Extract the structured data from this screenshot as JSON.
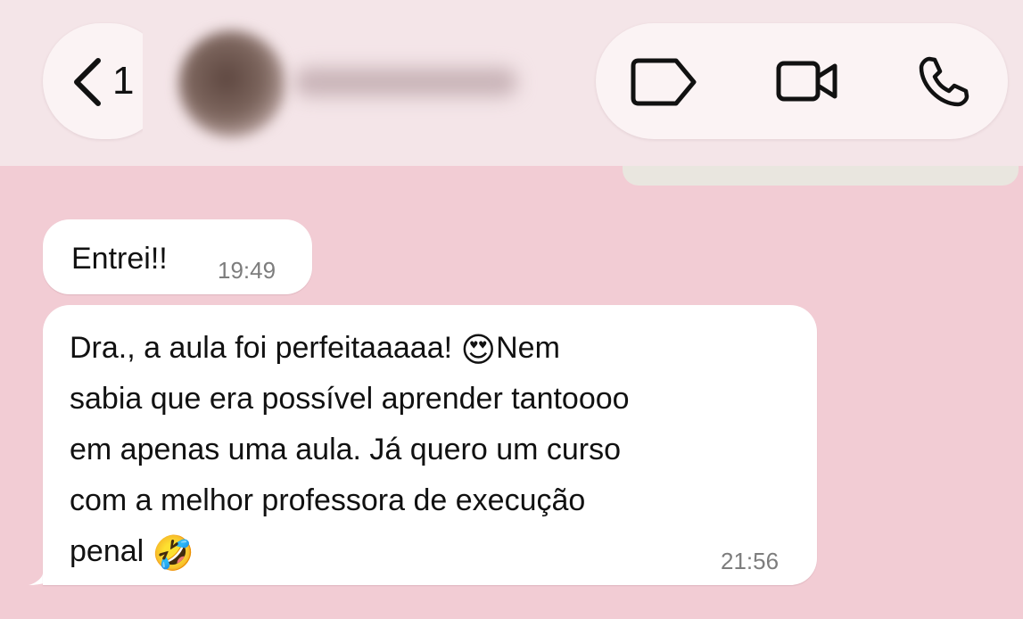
{
  "header": {
    "back_count": "1",
    "icons": {
      "back": "chevron-left-icon",
      "label": "tag-icon",
      "video": "video-camera-icon",
      "call": "phone-icon"
    }
  },
  "messages": [
    {
      "direction": "incoming",
      "text": "Entrei!!",
      "time": "19:49"
    },
    {
      "direction": "incoming",
      "text_parts": [
        "Dra., a aula foi perfeitaaaaa! ",
        "😍",
        "Nem\nsabia que era possível aprender tantoooo\nem apenas uma aula. Já quero um curso\ncom a melhor professora de execução\npenal ",
        "🤣"
      ],
      "time": "21:56"
    }
  ],
  "colors": {
    "chat_background": "#f2ccd4",
    "header_background": "#f4e5e8",
    "bubble_incoming": "#ffffff",
    "timestamp": "#7d7d7d"
  }
}
